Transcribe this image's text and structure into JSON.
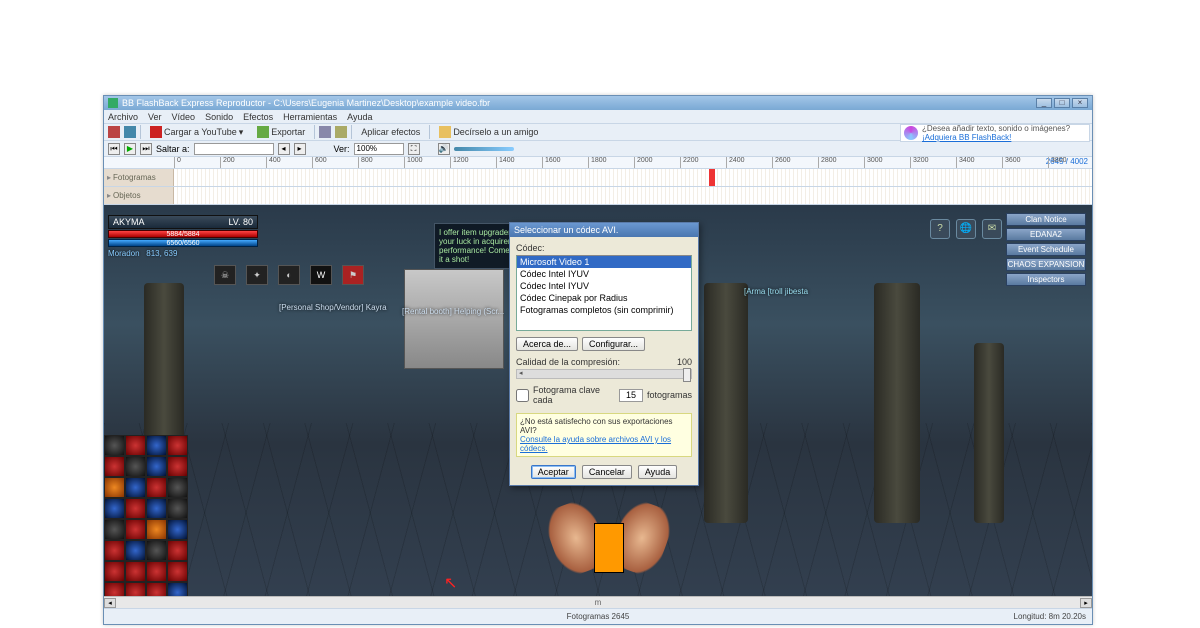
{
  "window": {
    "title": "BB FlashBack Express Reproductor - C:\\Users\\Eugenia Martinez\\Desktop\\example video.fbr"
  },
  "menubar": [
    "Archivo",
    "Ver",
    "Vídeo",
    "Sonido",
    "Efectos",
    "Herramientas",
    "Ayuda"
  ],
  "toolbar": {
    "upload": "Cargar a YouTube",
    "export": "Exportar",
    "apply_fx": "Aplicar efectos",
    "tell_friend": "Decírselo a un amigo"
  },
  "toolbar2": {
    "jump_label": "Saltar a:",
    "view_label": "Ver:",
    "zoom": "100%"
  },
  "promo": {
    "text": "¿Desea añadir texto, sonido o imágenes?",
    "link": "¡Adquiera BB FlashBack!"
  },
  "ruler": {
    "ticks": [
      "0",
      "200",
      "400",
      "600",
      "800",
      "1000",
      "1200",
      "1400",
      "1600",
      "1800",
      "2000",
      "2200",
      "2400",
      "2600",
      "2800",
      "3000",
      "3200",
      "3400",
      "3600",
      "3800"
    ],
    "counter": "2645 / 4002"
  },
  "tracks": {
    "frames": "Fotogramas",
    "objects": "Objetos"
  },
  "game": {
    "char_name": "AKYMA",
    "level": "LV. 80",
    "hp": "5884/5884",
    "mp": "6560/6560",
    "clan": "Moradon",
    "coords": "813, 639",
    "npc_booth1": "[Personal Shop/Vendor] Kayra",
    "npc_booth2": "[Rental booth] Helping (Scr...",
    "npc_right": "[Arma   [troll   jibesta",
    "tooltip": "I offer item upgrader, your luck in acquirer high performance! Come give it a shot!",
    "menu": [
      "Clan Notice",
      "EDANA2",
      "Event Schedule",
      "CHAOS EXPANSION",
      "Inspectors"
    ]
  },
  "dialog": {
    "title": "Seleccionar un códec AVI.",
    "codec_label": "Códec:",
    "options": [
      "Microsoft Video 1",
      "Códec Intel IYUV",
      "Códec Intel IYUV",
      "Códec Cinepak por Radius",
      "Fotogramas completos (sin comprimir)"
    ],
    "about": "Acerca de...",
    "configure": "Configurar...",
    "quality_label": "Calidad de la compresión:",
    "quality_value": "100",
    "keyframe_chk": "Fotograma clave cada",
    "keyframe_val": "15",
    "keyframe_suffix": "fotogramas",
    "hint_q": "¿No está satisfecho con sus exportaciones AVI?",
    "hint_link": "Consulte la ayuda sobre archivos AVI y los códecs.",
    "ok": "Aceptar",
    "cancel": "Cancelar",
    "help": "Ayuda"
  },
  "statusbar": {
    "frames": "Fotogramas 2645",
    "length": "Longitud: 8m 20.20s",
    "scroll_label": "m"
  }
}
